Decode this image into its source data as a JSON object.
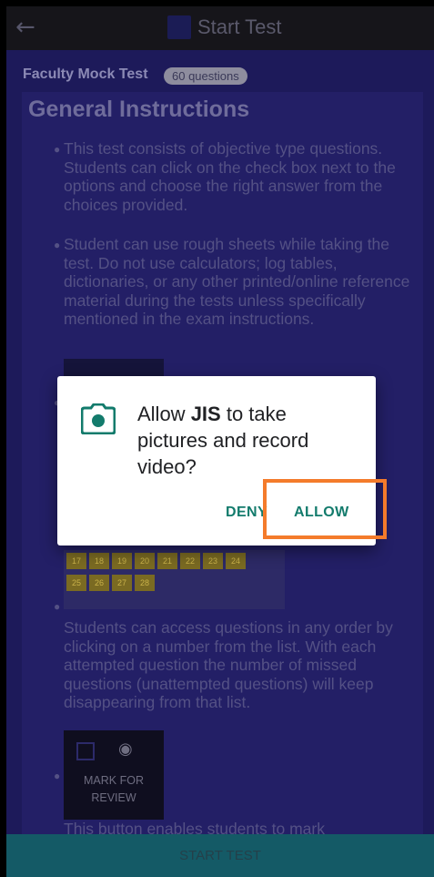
{
  "topbar": {
    "title": "Start Test",
    "back_icon": "arrow-left-icon"
  },
  "test": {
    "name": "Faculty Mock Test",
    "badge": "60 questions"
  },
  "instructions": {
    "heading": "General Instructions",
    "items": [
      "This test consists of objective type questions. Students can click on the check box next to the options and choose the right answer from the choices provided.",
      "Student can use rough sheets while taking the test. Do not use calculators; log tables, dictionaries, or any other printed/online reference material during the tests unless specifically mentioned in the exam instructions.",
      "Students can access questions in any order by clicking on a number from the list. With each attempted question the number of missed questions (unattempted questions) will keep disappearing from that list.",
      "This button enables students to mark"
    ],
    "grid_numbers": [
      "17",
      "18",
      "19",
      "20",
      "21",
      "22",
      "23",
      "24",
      "25",
      "26",
      "27",
      "28"
    ],
    "mark_review": {
      "line1": "MARK FOR",
      "line2": "REVIEW"
    }
  },
  "start_button": "START TEST",
  "dialog": {
    "icon": "camera-icon",
    "prefix": "Allow ",
    "app": "JIS",
    "suffix": " to take pictures and record video?",
    "deny": "DENY",
    "allow": "ALLOW"
  },
  "colors": {
    "highlight": "#f47b2b",
    "dialog_button": "#137b6c",
    "overlay_bg": "#1d1a5a"
  }
}
